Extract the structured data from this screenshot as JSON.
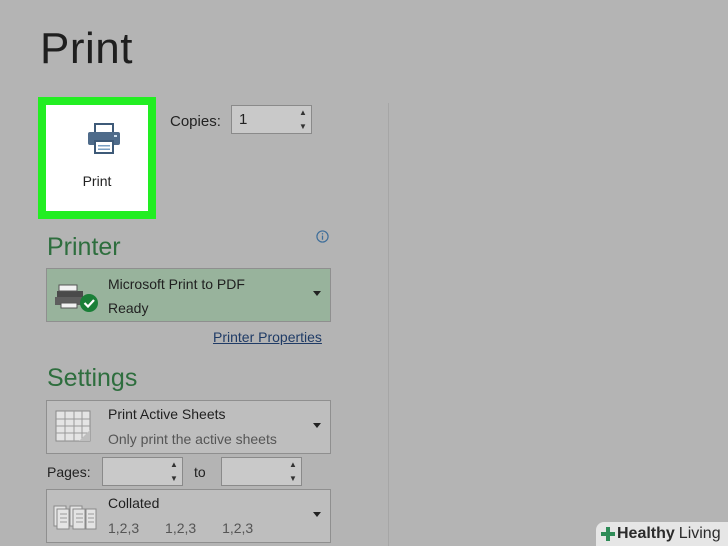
{
  "header": {
    "title": "Print"
  },
  "print_button": {
    "label": "Print",
    "icon": "printer-icon"
  },
  "copies": {
    "label": "Copies:",
    "value": "1"
  },
  "printer": {
    "section_title": "Printer",
    "info_icon": "info-icon",
    "name": "Microsoft Print to PDF",
    "status": "Ready",
    "properties_link": "Printer Properties",
    "accent": "#98b39c"
  },
  "settings": {
    "section_title": "Settings",
    "print_what": {
      "main": "Print Active Sheets",
      "sub": "Only print the active sheets"
    },
    "pages": {
      "label": "Pages:",
      "to_label": "to",
      "from_value": "",
      "to_value": ""
    },
    "collation": {
      "main": "Collated",
      "sub": [
        "1,2,3",
        "1,2,3",
        "1,2,3"
      ]
    }
  },
  "watermark": {
    "part1": "Healthy",
    "part2": "Living"
  },
  "colors": {
    "highlight": "#22ee22",
    "section_title": "#2e6e3e",
    "background": "#b4b4b4"
  }
}
